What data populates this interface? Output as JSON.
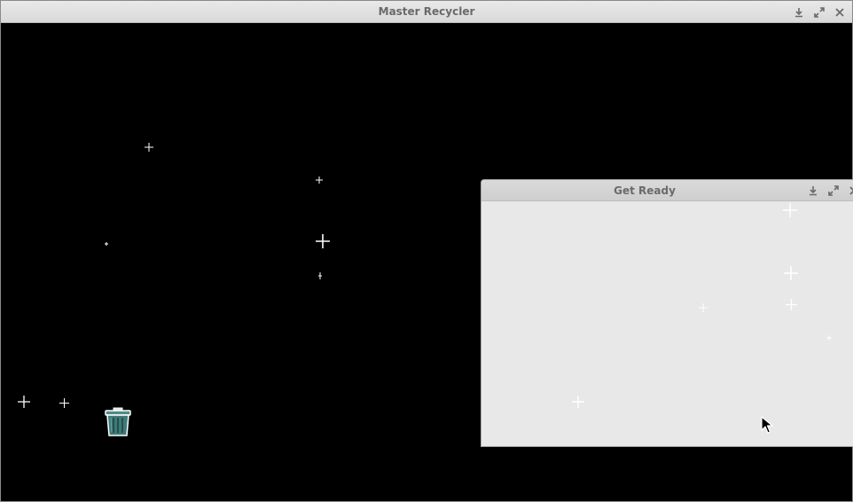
{
  "main_window": {
    "title": "Master Recycler",
    "buttons": [
      "minimize-icon",
      "maximize-icon",
      "close-icon"
    ]
  },
  "dialog_window": {
    "title": "Get Ready",
    "buttons": [
      "minimize-icon",
      "maximize-icon",
      "close-icon"
    ]
  },
  "colors": {
    "game_background": "#000000",
    "dialog_background": "#e8e8e8",
    "titlebar_text": "#6a6a6a",
    "trash_can": "#3d7a78"
  }
}
